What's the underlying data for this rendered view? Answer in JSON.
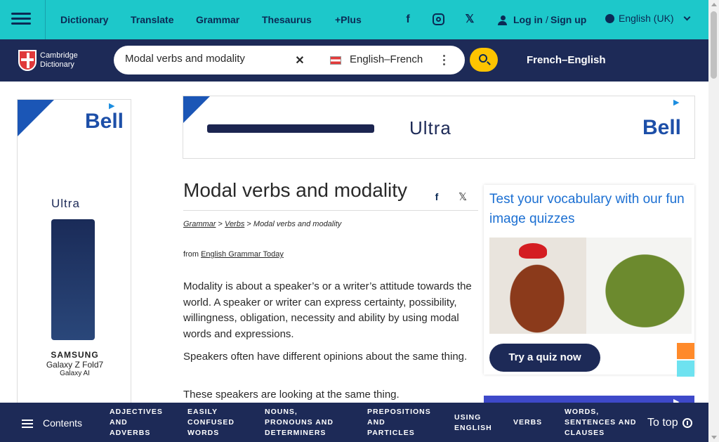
{
  "topbar": {
    "nav": [
      {
        "label": "Dictionary"
      },
      {
        "label": "Translate"
      },
      {
        "label": "Grammar"
      },
      {
        "label": "Thesaurus"
      },
      {
        "label": "+Plus"
      }
    ],
    "social": [
      "facebook-icon",
      "instagram-icon",
      "x-icon"
    ],
    "login": "Log in",
    "divider": "/",
    "signup": "Sign up",
    "language": "English (UK)"
  },
  "header": {
    "logo_line1": "Cambridge",
    "logo_line2": "Dictionary",
    "search_value": "Modal verbs and modality",
    "dictionary_select": "English–French",
    "switch_label": "French–English"
  },
  "ads": {
    "brand": "Bell",
    "product": "Ultra",
    "maker": "SAMSUNG",
    "model": "Galaxy Z Fold7",
    "tagline": "Galaxy AI"
  },
  "article": {
    "title": "Modal verbs and modality",
    "breadcrumb": {
      "level1": "Grammar",
      "sep": ">",
      "level2": "Verbs",
      "current": "Modal verbs and modality"
    },
    "source_prefix": "from",
    "source_link": "English Grammar Today",
    "p1": "Modality  is about a speaker’s or a writer’s attitude towards the world. A speaker or writer can express certainty, possibility, willingness, obligation, necessity and ability by using modal words and expressions.",
    "p2": "Speakers often have different opinions about the same thing.",
    "p3": "These speakers are looking at the same thing."
  },
  "quiz": {
    "title": "Test your vocabulary with our fun image quizzes",
    "button": "Try a quiz now"
  },
  "bottombar": {
    "contents": "Contents",
    "categories": [
      {
        "l1": "ADJECTIVES",
        "l2": "AND",
        "l3": "ADVERBS"
      },
      {
        "l1": "EASILY",
        "l2": "CONFUSED",
        "l3": "WORDS"
      },
      {
        "l1": "NOUNS,",
        "l2": "PRONOUNS AND",
        "l3": "DETERMINERS"
      },
      {
        "l1": "PREPOSITIONS",
        "l2": "AND",
        "l3": "PARTICLES"
      },
      {
        "l1": "USING",
        "l2": "ENGLISH"
      },
      {
        "l1": "VERBS"
      },
      {
        "l1": "WORDS,",
        "l2": "SENTENCES AND",
        "l3": "CLAUSES"
      }
    ],
    "totop": "To top"
  },
  "colors": {
    "topbar": "#1dc8ca",
    "navy": "#1d2a57",
    "search_button": "#fec400",
    "link_blue": "#1b6fd2"
  }
}
